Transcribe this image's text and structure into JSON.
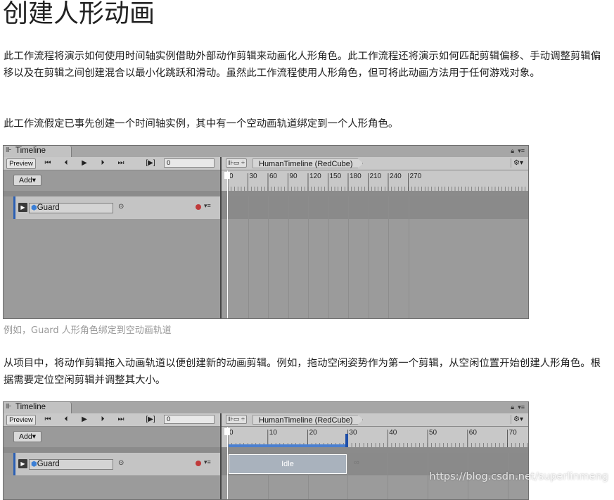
{
  "title": "创建人形动画",
  "paragraphs": {
    "p1": "此工作流程将演示如何使用时间轴实例借助外部动作剪辑来动画化人形角色。此工作流程还将演示如何匹配剪辑偏移、手动调整剪辑偏移以及在剪辑之间创建混合以最小化跳跃和滑动。虽然此工作流程使用人形角色，但可将此动画方法用于任何游戏对象。",
    "p2": "此工作流假定已事先创建一个时间轴实例，其中有一个空动画轨道绑定到一个人形角色。",
    "p3": "从项目中，将动作剪辑拖入动画轨道以便创建新的动画剪辑。例如，拖动空闲姿势作为第一个剪辑，从空闲位置开始创建人形角色。根据需要定位空闲剪辑并调整其大小。"
  },
  "caption1": "例如，Guard 人形角色绑定到空动画轨道",
  "timeline": {
    "tab_label": "Timeline",
    "tab_icon": "timeline-icon",
    "preview_label": "Preview",
    "frame_value": "0",
    "add_label": "Add▾",
    "asset_name": "HumanTimeline (RedCube)",
    "track_name": "Guard",
    "ruler1": [
      "0",
      "30",
      "60",
      "90",
      "120",
      "150",
      "180",
      "210",
      "240",
      "270"
    ],
    "ruler2": [
      "0",
      "10",
      "20",
      "30",
      "40",
      "50",
      "60",
      "70"
    ],
    "clip_name": "Idle",
    "record_color": "#c03a3a",
    "accent_color": "#2a5fb4"
  },
  "watermark": "https://blog.csdn.net/superlinmeng"
}
